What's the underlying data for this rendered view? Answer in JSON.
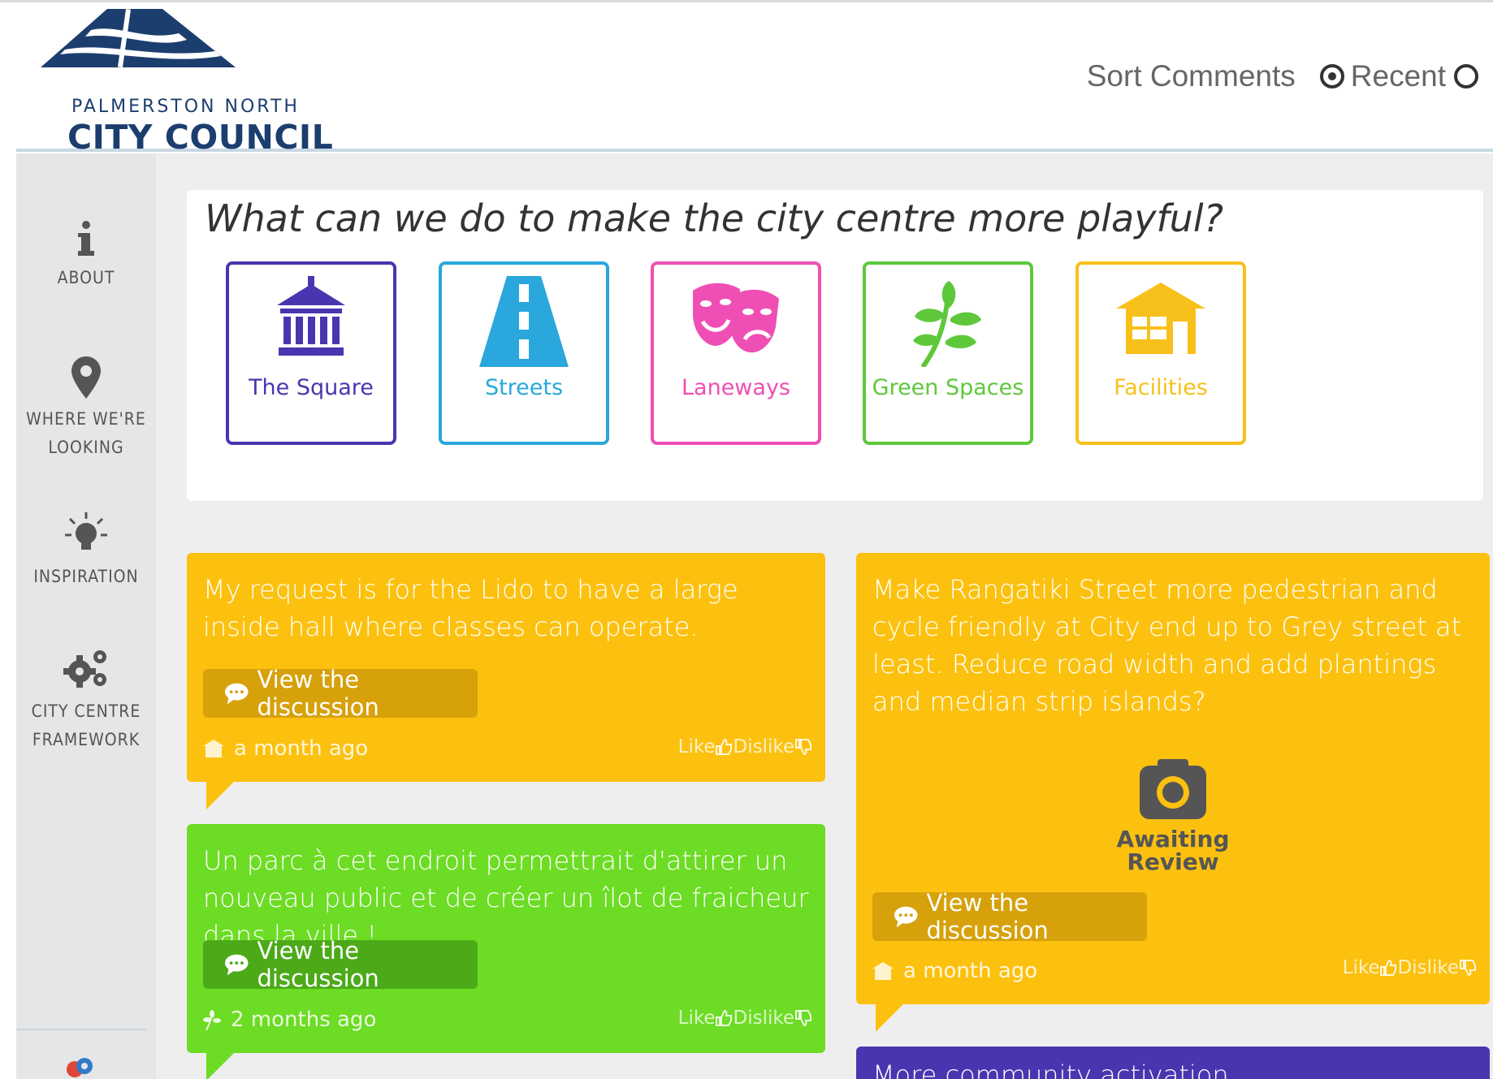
{
  "header": {
    "logo_line1": "PALMERSTON NORTH",
    "logo_line2": "CITY COUNCIL",
    "sort_label": "Sort Comments",
    "sort_options": [
      {
        "label": "Recent",
        "checked": true
      },
      {
        "label": "",
        "checked": false
      }
    ]
  },
  "sidebar": {
    "items": [
      {
        "label": "ABOUT",
        "icon": "info-icon"
      },
      {
        "label": "WHERE WE'RE LOOKING",
        "line1": "WHERE WE'RE",
        "line2": "LOOKING",
        "icon": "map-pin-icon"
      },
      {
        "label": "INSPIRATION",
        "icon": "lightbulb-icon"
      },
      {
        "label": "CITY CENTRE FRAMEWORK",
        "line1": "CITY CENTRE",
        "line2": "FRAMEWORK",
        "icon": "gears-icon"
      }
    ]
  },
  "question": "What can we do to make the city centre more playful?",
  "categories": [
    {
      "label": "The Square",
      "color": "#4a35b0",
      "icon": "building-columns-icon"
    },
    {
      "label": "Streets",
      "color": "#2aa7dc",
      "icon": "road-icon"
    },
    {
      "label": "Laneways",
      "color": "#ef4fb4",
      "icon": "theatre-masks-icon"
    },
    {
      "label": "Green Spaces",
      "color": "#5ec83a",
      "icon": "plant-icon"
    },
    {
      "label": "Facilities",
      "color": "#f8c01a",
      "icon": "house-icon"
    }
  ],
  "cards": [
    {
      "text": "My request is for the Lido to have a large inside hall where classes can operate.",
      "button": "View the discussion",
      "time": "a month ago",
      "like": "Like",
      "dislike": "Dislike",
      "color": "#fcc10f",
      "button_color": "#d6a10b",
      "category_icon": "house-icon"
    },
    {
      "text": "Un parc à cet endroit permettrait d'attirer un nouveau public et de créer un îlot de fraicheur dans la ville !",
      "button": "View the discussion",
      "time": "2 months ago",
      "like": "Like",
      "dislike": "Dislike",
      "color": "#6cdc24",
      "button_color": "#4caa18",
      "category_icon": "plant-icon"
    },
    {
      "text": "Make Rangatiki Street more pedestrian and cycle friendly at City end up to Grey street at least. Reduce road width and add plantings and median strip islands?",
      "awaiting_line1": "Awaiting",
      "awaiting_line2": "Review",
      "button": "View the discussion",
      "time": "a month ago",
      "like": "Like",
      "dislike": "Dislike",
      "color": "#fcc10f",
      "button_color": "#d6a10b",
      "category_icon": "house-icon"
    },
    {
      "text": "More community activation",
      "color": "#4a35b0"
    }
  ]
}
